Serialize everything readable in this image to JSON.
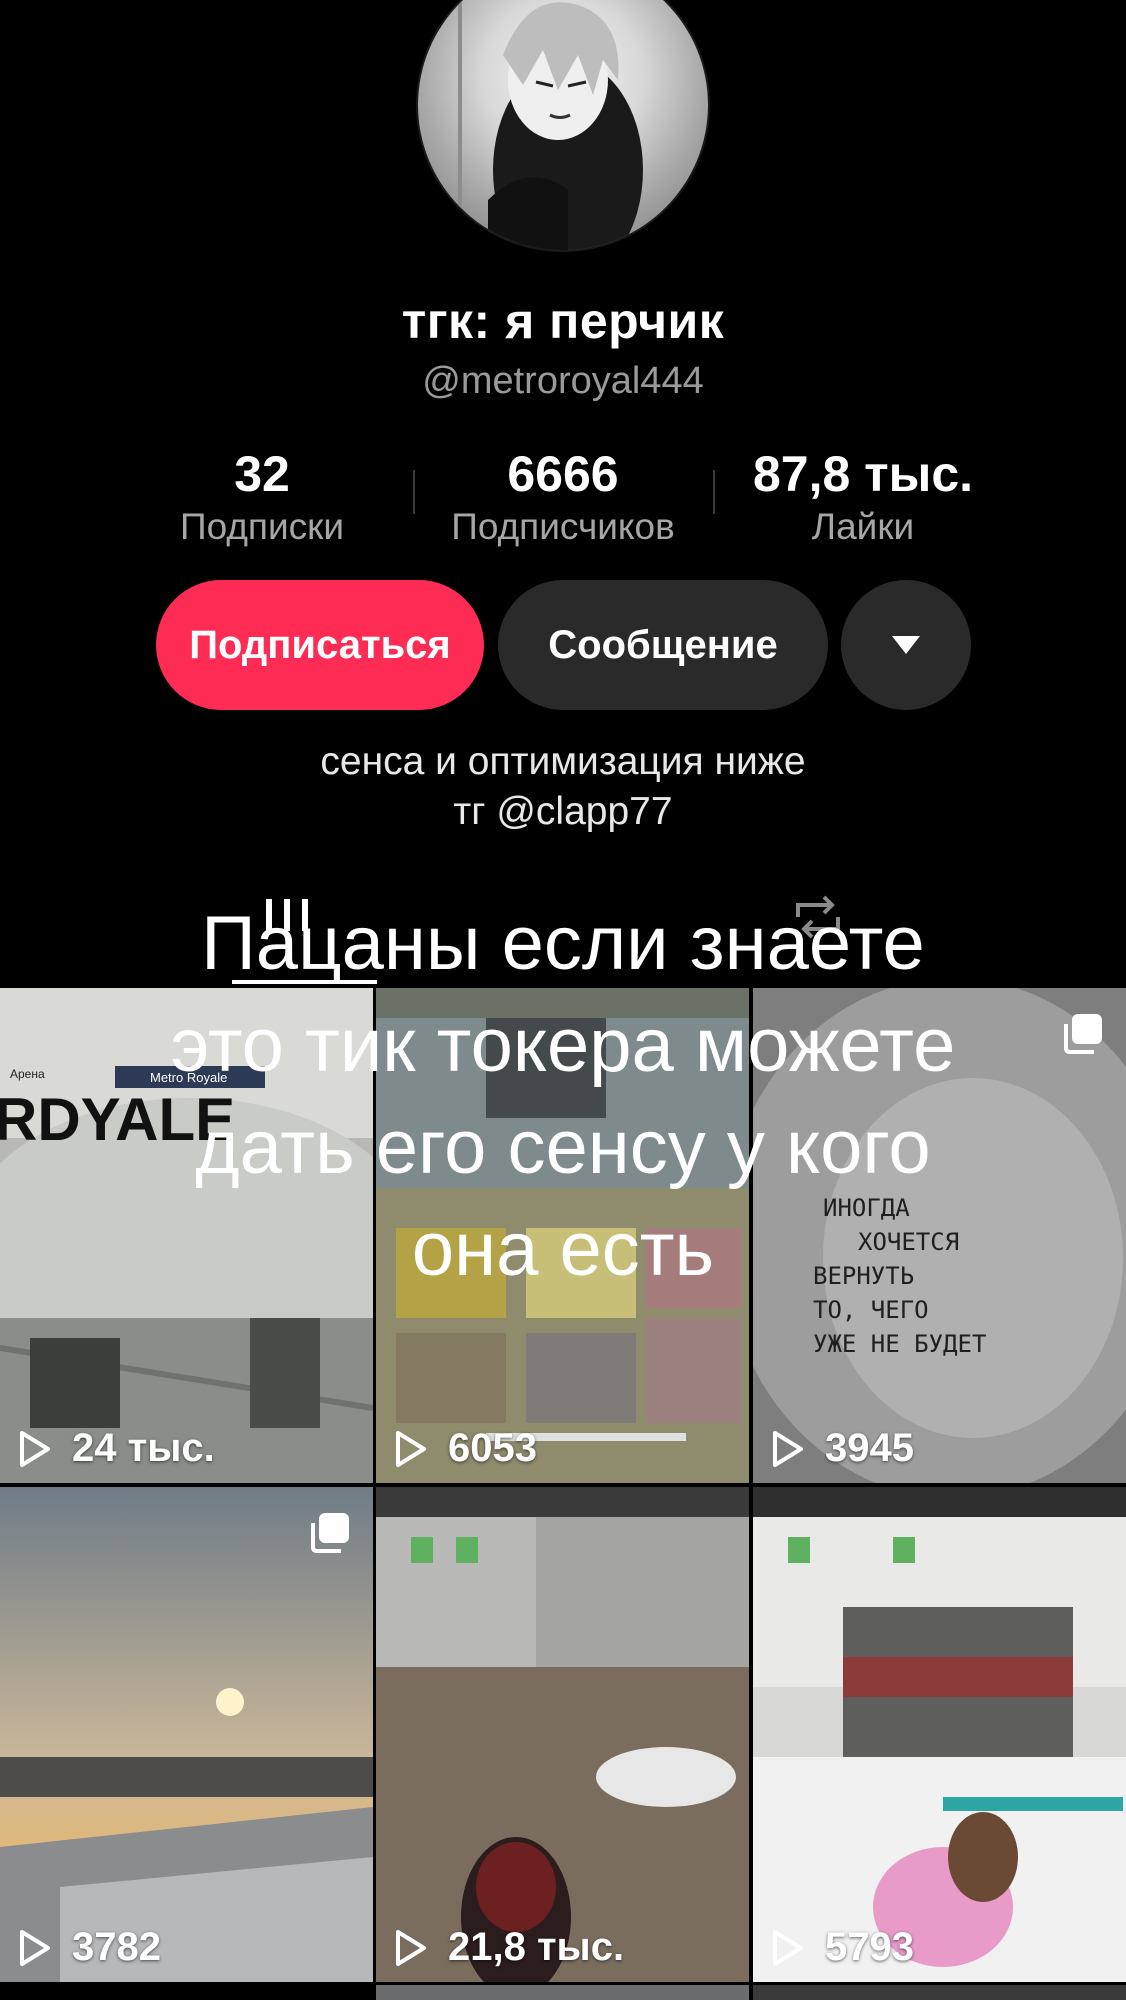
{
  "profile": {
    "display_name": "тгк: я перчик",
    "username": "@metroroyal444"
  },
  "stats": [
    {
      "value": "32",
      "label": "Подписки"
    },
    {
      "value": "6666",
      "label": "Подписчиков"
    },
    {
      "value": "87,8 тыс.",
      "label": "Лайки"
    }
  ],
  "actions": {
    "follow": "Подписаться",
    "message": "Сообщение"
  },
  "bio": {
    "line1": "сенса и оптимизация ниже",
    "line2": "тг @clapp77"
  },
  "caption_overlay": [
    "Пацаны если знаете",
    "это тик токера можете",
    "дать его сенсу у кого",
    "она есть"
  ],
  "videos": [
    {
      "views": "24 тыс.",
      "thumb_text": [
        "Арена",
        "Metro Royale",
        "RDYALE"
      ]
    },
    {
      "views": "6053"
    },
    {
      "views": "3945",
      "multi_photo": true,
      "thumb_text": [
        "ИНОГДА",
        "ХОЧЕТСЯ",
        "ВЕРНУТЬ",
        "ТО, ЧЕГО",
        "УЖЕ НЕ БУДЕТ"
      ]
    },
    {
      "views": "3782",
      "multi_photo": true
    },
    {
      "views": "21,8 тыс."
    },
    {
      "views": "5793"
    }
  ],
  "colors": {
    "follow_button": "#fe2c55",
    "secondary_button": "#2a2a2a",
    "background": "#000000"
  }
}
